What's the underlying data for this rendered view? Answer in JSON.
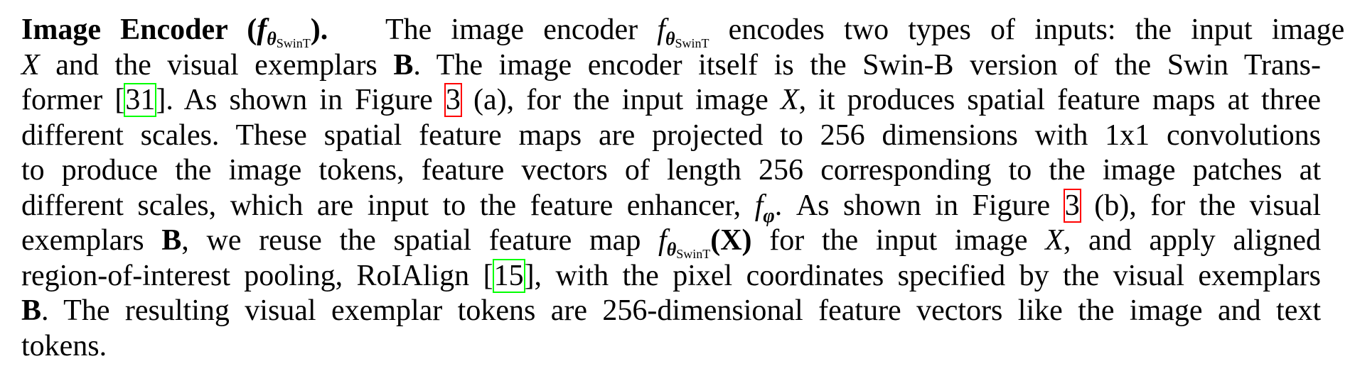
{
  "paragraph": {
    "heading": "Image Encoder",
    "lines": [
      {
        "pre": " The image encoder ",
        "post": " encodes two types of inputs: the input image"
      },
      {
        "var_x": "X",
        "t1": " and the visual exemplars ",
        "var_b": "B",
        "t2": ". The image encoder itself is the Swin-B version of the Swin Trans-"
      },
      {
        "t1": "former [",
        "cite": "31",
        "t2": "]. As shown in Figure ",
        "ref": "3",
        "t3": " (a), for the input image ",
        "var_x": "X",
        "t4": ", it produces spatial feature maps at three"
      },
      {
        "text": "different scales. These spatial feature maps are projected to 256 dimensions with 1x1 convolutions"
      },
      {
        "text": "to produce the image tokens, feature vectors of length 256 corresponding to the image patches at"
      },
      {
        "t1": "different scales, which are input to the feature enhancer, ",
        "f": "f",
        "phi": "φ",
        "t2": ". As shown in Figure ",
        "ref": "3",
        "t3": " (b), for the visual"
      },
      {
        "t1": "exemplars ",
        "var_b": "B",
        "t2": ", we reuse the spatial feature map ",
        "arg": "(X)",
        "t3": " for the input image ",
        "var_x": "X",
        "t4": ", and apply aligned"
      },
      {
        "t1": "region-of-interest pooling, RoIAlign [",
        "cite": "15",
        "t2": "], with the pixel coordinates specified by the visual exemplars"
      },
      {
        "var_b": "B",
        "t1": ". The resulting visual exemplar tokens are 256-dimensional feature vectors like the image and text"
      },
      {
        "text": "tokens."
      }
    ],
    "math": {
      "f": "f",
      "theta": "θ",
      "swint": "SwinT"
    }
  }
}
